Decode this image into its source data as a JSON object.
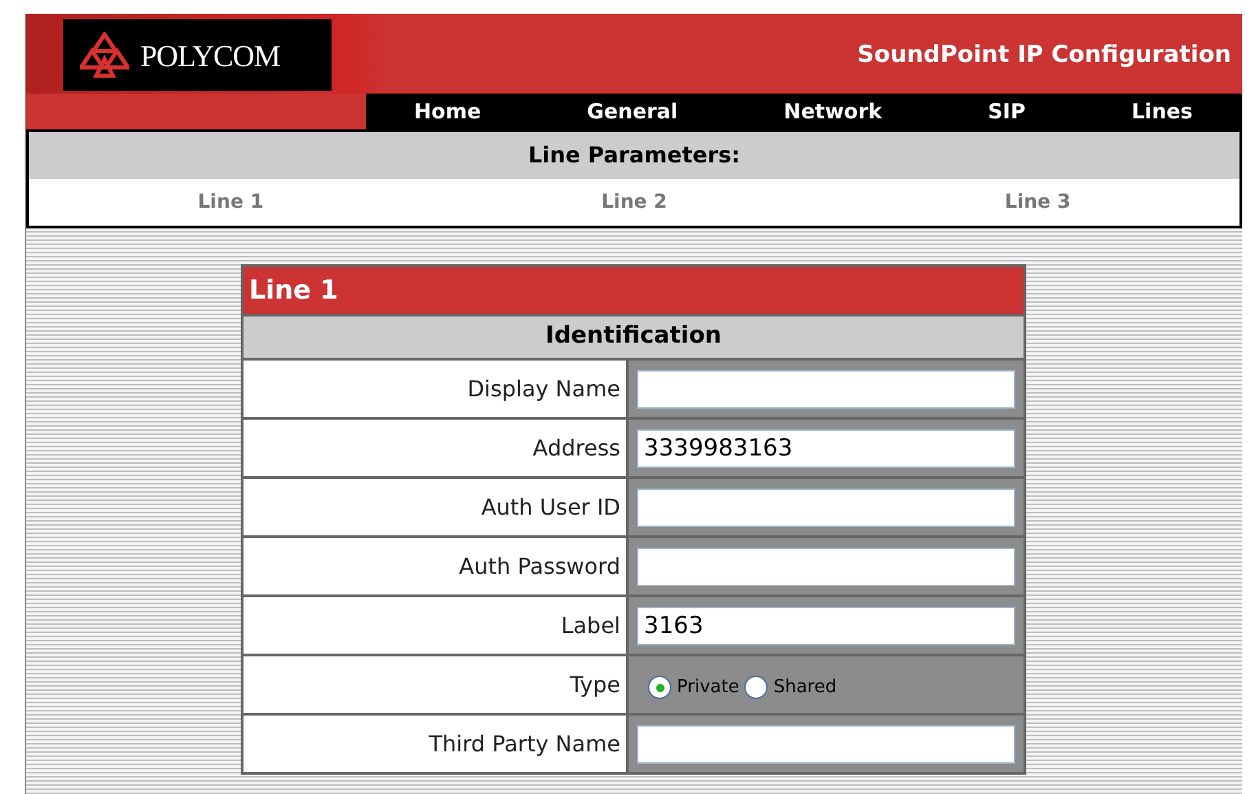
{
  "header": {
    "logo": "POLYCOM",
    "title": "SoundPoint IP Configuration"
  },
  "nav": [
    "Home",
    "General",
    "Network",
    "SIP",
    "Lines"
  ],
  "section": {
    "title": "Line Parameters:",
    "lines": [
      "Line 1",
      "Line 2",
      "Line 3"
    ]
  },
  "form": {
    "title": "Line 1",
    "group": "Identification",
    "fields": [
      {
        "kind": "text",
        "label": "Display Name"
      },
      {
        "kind": "text",
        "label": "Address",
        "value": "3339983163"
      },
      {
        "kind": "text",
        "label": "Auth User ID"
      },
      {
        "kind": "text",
        "label": "Auth Password"
      },
      {
        "kind": "text",
        "label": "Label",
        "value": "3163"
      },
      {
        "kind": "radio",
        "label": "Type",
        "options": [
          {
            "label": "Private",
            "selected": true
          },
          {
            "label": "Shared",
            "selected": false
          }
        ]
      },
      {
        "kind": "text",
        "label": "Third Party Name"
      }
    ]
  }
}
